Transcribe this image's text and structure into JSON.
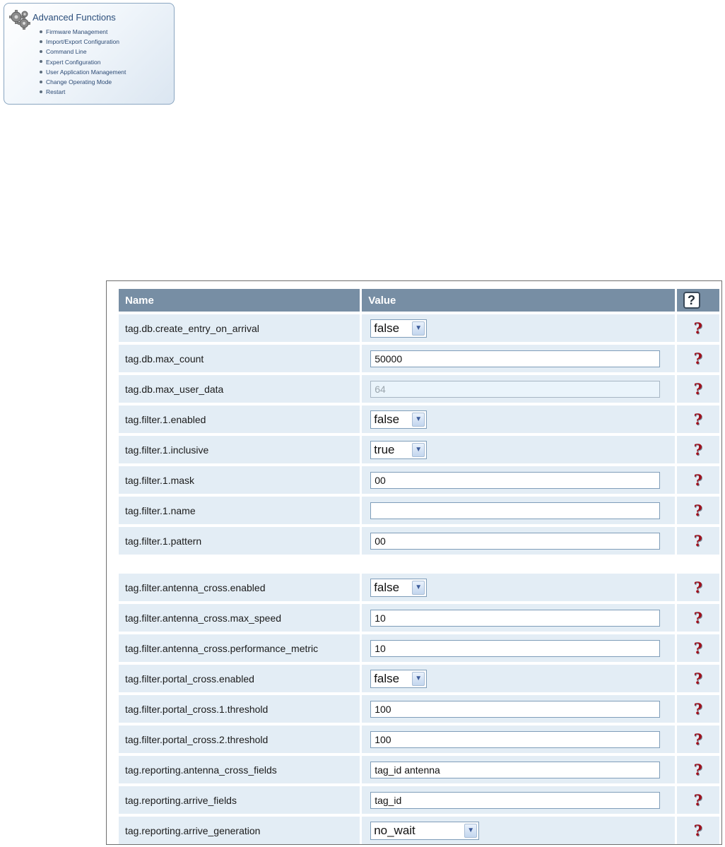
{
  "advanced_functions": {
    "title": "Advanced Functions",
    "icon": "gears-icon",
    "items": [
      "Firmware Management",
      "Import/Export Configuration",
      "Command Line",
      "Expert Configuration",
      "User Application Management",
      "Change Operating Mode",
      "Restart"
    ]
  },
  "config_table": {
    "headers": {
      "name": "Name",
      "value": "Value",
      "help": "?"
    },
    "rows": [
      {
        "name": "tag.db.create_entry_on_arrival",
        "type": "select",
        "value": "false"
      },
      {
        "name": "tag.db.max_count",
        "type": "text",
        "value": "50000"
      },
      {
        "name": "tag.db.max_user_data",
        "type": "readonly",
        "value": "64"
      },
      {
        "name": "tag.filter.1.enabled",
        "type": "select",
        "value": "false"
      },
      {
        "name": "tag.filter.1.inclusive",
        "type": "select",
        "value": "true"
      },
      {
        "name": "tag.filter.1.mask",
        "type": "text",
        "value": "00"
      },
      {
        "name": "tag.filter.1.name",
        "type": "text",
        "value": ""
      },
      {
        "name": "tag.filter.1.pattern",
        "type": "text",
        "value": "00"
      },
      {
        "name": "tag.filter.antenna_cross.enabled",
        "type": "select",
        "value": "false"
      },
      {
        "name": "tag.filter.antenna_cross.max_speed",
        "type": "text",
        "value": "10"
      },
      {
        "name": "tag.filter.antenna_cross.performance_metric",
        "type": "text",
        "value": "10"
      },
      {
        "name": "tag.filter.portal_cross.enabled",
        "type": "select",
        "value": "false"
      },
      {
        "name": "tag.filter.portal_cross.1.threshold",
        "type": "text",
        "value": "100"
      },
      {
        "name": "tag.filter.portal_cross.2.threshold",
        "type": "text",
        "value": "100"
      },
      {
        "name": "tag.reporting.antenna_cross_fields",
        "type": "text",
        "value": "tag_id antenna"
      },
      {
        "name": "tag.reporting.arrive_fields",
        "type": "text",
        "value": "tag_id"
      },
      {
        "name": "tag.reporting.arrive_generation",
        "type": "select",
        "value": "no_wait"
      }
    ],
    "help_icon": "?",
    "colors": {
      "header_bg": "#778ea4",
      "row_bg": "#e3edf5",
      "help_icon": "#a0101c"
    }
  }
}
